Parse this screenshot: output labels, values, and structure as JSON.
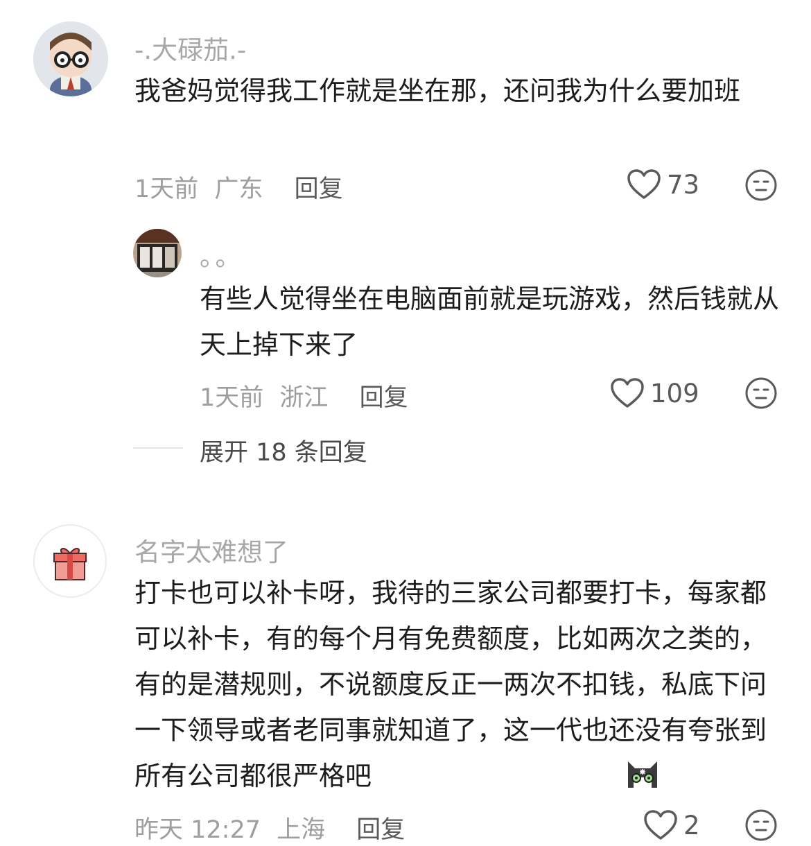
{
  "comments": [
    {
      "username": "-.大碌茄.-",
      "text": "我爸妈觉得我工作就是坐在那，还问我为什么要加班",
      "time": "1天前",
      "location": "广东",
      "reply_label": "回复",
      "likes": "73",
      "replies": [
        {
          "username": "。。",
          "text": "有些人觉得坐在电脑面前就是玩游戏，然后钱就从天上掉下来了",
          "time": "1天前",
          "location": "浙江",
          "reply_label": "回复",
          "likes": "109"
        }
      ],
      "expand_label": "展开 18 条回复"
    },
    {
      "username": "名字太难想了",
      "text": "打卡也可以补卡呀，我待的三家公司都要打卡，每家都可以补卡，有的每个月有免费额度，比如两次之类的，有的是潜规则，不说额度反正一两次不扣钱，私底下问一下领导或者老同事就知道了，这一代也还没有夸张到所有公司都很严格吧",
      "time": "昨天 12:27",
      "location": "上海",
      "reply_label": "回复",
      "likes": "2"
    }
  ],
  "icons": {
    "like": "heart-outline-icon",
    "dislike": "meh-face-icon",
    "gift_avatar": "gift-icon",
    "cat_emoji": "cat-emoji-icon"
  },
  "colors": {
    "username": "#a8a8a8",
    "text": "#1d1d1d",
    "meta": "#9e9e9e",
    "action": "#5a5a5a"
  }
}
